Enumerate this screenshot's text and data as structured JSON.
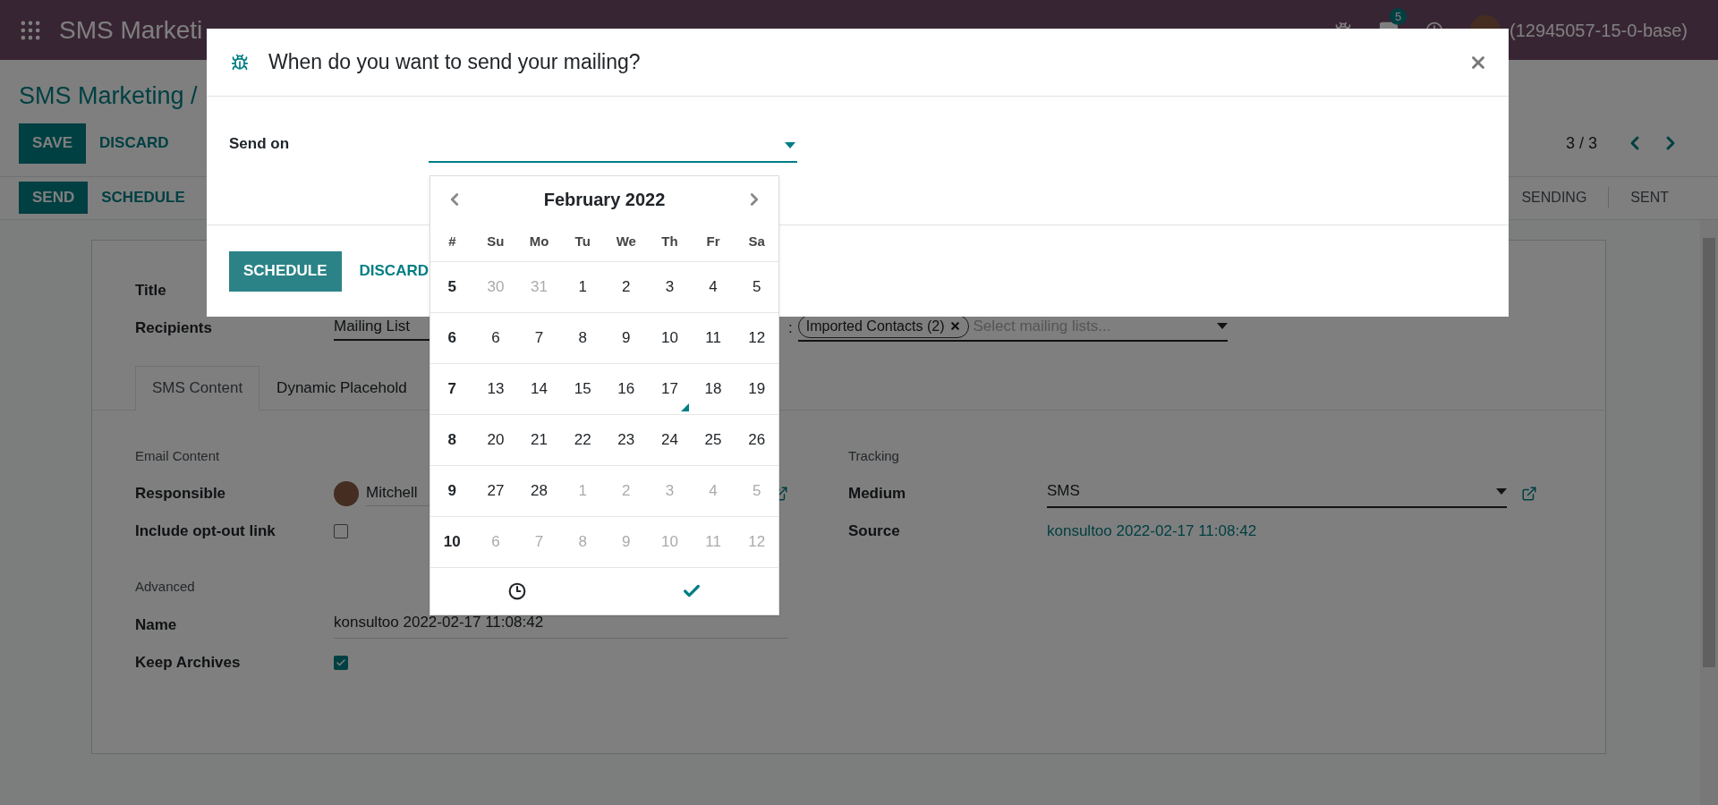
{
  "navbar": {
    "app_name": "SMS Marketi",
    "chat_badge": "5",
    "user": "(12945057-15-0-base)"
  },
  "breadcrumb": "SMS Marketing /",
  "form_buttons": [
    {
      "label": "SAVE",
      "kind": "primary"
    },
    {
      "label": "DISCARD",
      "kind": "secondary"
    }
  ],
  "pager": "3 / 3",
  "status_buttons": [
    {
      "label": "SEND",
      "kind": "primary"
    },
    {
      "label": "SCHEDULE",
      "kind": "secondary"
    }
  ],
  "stages": [
    "SENDING",
    "SENT"
  ],
  "sheet": {
    "title_label": "Title",
    "recipients_label": "Recipients",
    "recipients_value": "Mailing List",
    "lists_prefix": ":",
    "tags": [
      "Imported Contacts (2)"
    ],
    "lists_placeholder": "Select mailing lists...",
    "tabs": [
      {
        "label": "SMS Content",
        "selected": true
      },
      {
        "label": "Dynamic Placehold",
        "selected": false
      }
    ],
    "left_groups": [
      {
        "heading": "Email Content",
        "fields": [
          {
            "kind": "user",
            "label": "Responsible",
            "value": "Mitchell"
          },
          {
            "kind": "checkbox",
            "label": "Include opt-out link",
            "checked": false
          }
        ]
      },
      {
        "heading": "Advanced",
        "fields": [
          {
            "kind": "text",
            "label": "Name",
            "value": "konsultoo 2022-02-17 11:08:42"
          },
          {
            "kind": "checkbox",
            "label": "Keep Archives",
            "checked": true
          }
        ]
      }
    ],
    "right_group": {
      "heading": "Tracking",
      "fields": [
        {
          "kind": "select",
          "label": "Medium",
          "value": "SMS"
        },
        {
          "kind": "link",
          "label": "Source",
          "value": "konsultoo 2022-02-17 11:08:42"
        }
      ]
    }
  },
  "dialog": {
    "title": "When do you want to send your mailing?",
    "field_label": "Send on",
    "buttons": [
      {
        "label": "SCHEDULE",
        "kind": "primary"
      },
      {
        "label": "DISCARD",
        "kind": "secondary"
      }
    ],
    "calendar": {
      "month": "February 2022",
      "week_header": "#",
      "weekdays": [
        "Su",
        "Mo",
        "Tu",
        "We",
        "Th",
        "Fr",
        "Sa"
      ],
      "weeks": [
        {
          "number": "5",
          "days": [
            {
              "day": "30",
              "muted": true,
              "today": false
            },
            {
              "day": "31",
              "muted": true,
              "today": false
            },
            {
              "day": "1",
              "muted": false,
              "today": false
            },
            {
              "day": "2",
              "muted": false,
              "today": false
            },
            {
              "day": "3",
              "muted": false,
              "today": false
            },
            {
              "day": "4",
              "muted": false,
              "today": false
            },
            {
              "day": "5",
              "muted": false,
              "today": false
            }
          ]
        },
        {
          "number": "6",
          "days": [
            {
              "day": "6",
              "muted": false,
              "today": false
            },
            {
              "day": "7",
              "muted": false,
              "today": false
            },
            {
              "day": "8",
              "muted": false,
              "today": false
            },
            {
              "day": "9",
              "muted": false,
              "today": false
            },
            {
              "day": "10",
              "muted": false,
              "today": false
            },
            {
              "day": "11",
              "muted": false,
              "today": false
            },
            {
              "day": "12",
              "muted": false,
              "today": false
            }
          ]
        },
        {
          "number": "7",
          "days": [
            {
              "day": "13",
              "muted": false,
              "today": false
            },
            {
              "day": "14",
              "muted": false,
              "today": false
            },
            {
              "day": "15",
              "muted": false,
              "today": false
            },
            {
              "day": "16",
              "muted": false,
              "today": false
            },
            {
              "day": "17",
              "muted": false,
              "today": true
            },
            {
              "day": "18",
              "muted": false,
              "today": false
            },
            {
              "day": "19",
              "muted": false,
              "today": false
            }
          ]
        },
        {
          "number": "8",
          "days": [
            {
              "day": "20",
              "muted": false,
              "today": false
            },
            {
              "day": "21",
              "muted": false,
              "today": false
            },
            {
              "day": "22",
              "muted": false,
              "today": false
            },
            {
              "day": "23",
              "muted": false,
              "today": false
            },
            {
              "day": "24",
              "muted": false,
              "today": false
            },
            {
              "day": "25",
              "muted": false,
              "today": false
            },
            {
              "day": "26",
              "muted": false,
              "today": false
            }
          ]
        },
        {
          "number": "9",
          "days": [
            {
              "day": "27",
              "muted": false,
              "today": false
            },
            {
              "day": "28",
              "muted": false,
              "today": false
            },
            {
              "day": "1",
              "muted": true,
              "today": false
            },
            {
              "day": "2",
              "muted": true,
              "today": false
            },
            {
              "day": "3",
              "muted": true,
              "today": false
            },
            {
              "day": "4",
              "muted": true,
              "today": false
            },
            {
              "day": "5",
              "muted": true,
              "today": false
            }
          ]
        },
        {
          "number": "10",
          "days": [
            {
              "day": "6",
              "muted": true,
              "today": false
            },
            {
              "day": "7",
              "muted": true,
              "today": false
            },
            {
              "day": "8",
              "muted": true,
              "today": false
            },
            {
              "day": "9",
              "muted": true,
              "today": false
            },
            {
              "day": "10",
              "muted": true,
              "today": false
            },
            {
              "day": "11",
              "muted": true,
              "today": false
            },
            {
              "day": "12",
              "muted": true,
              "today": false
            }
          ]
        }
      ]
    }
  }
}
